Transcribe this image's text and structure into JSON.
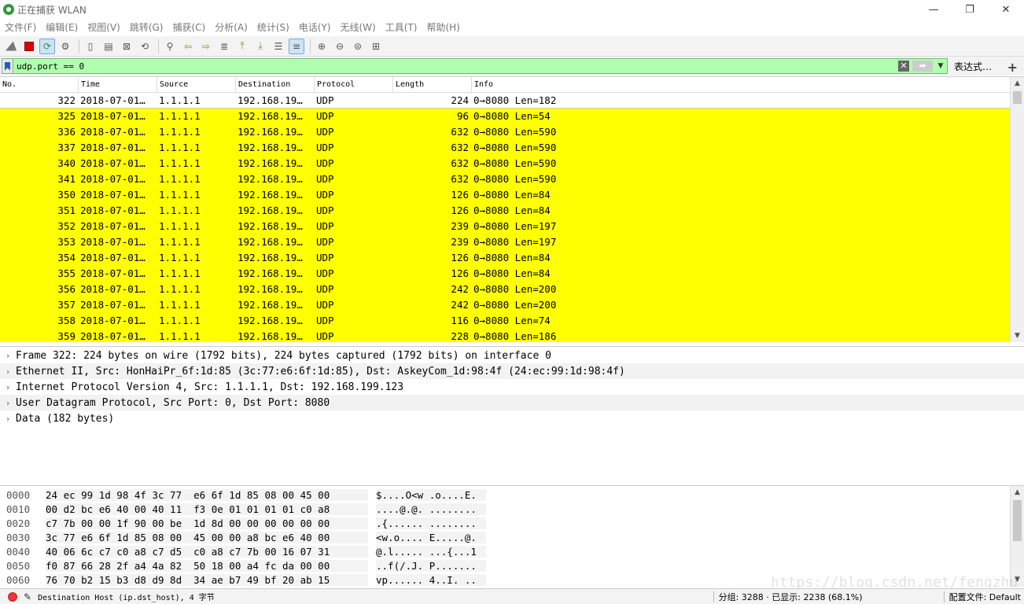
{
  "window": {
    "title": "正在捕获 WLAN",
    "minimize": "—",
    "maximize": "❐",
    "close": "✕"
  },
  "menu": [
    "文件(F)",
    "编辑(E)",
    "视图(V)",
    "跳转(G)",
    "捕获(C)",
    "分析(A)",
    "统计(S)",
    "电话(Y)",
    "无线(W)",
    "工具(T)",
    "帮助(H)"
  ],
  "filter": {
    "value": "udp.port == 0",
    "expression_label": "表达式…",
    "plus": "+"
  },
  "packet_list": {
    "columns": [
      "No.",
      "Time",
      "Source",
      "Destination",
      "Protocol",
      "Length",
      "Info"
    ],
    "rows": [
      {
        "no": "322",
        "time": "2018-07-01…",
        "src": "1.1.1.1",
        "dst": "192.168.19…",
        "proto": "UDP",
        "len": "224",
        "info": "0→8080 Len=182"
      },
      {
        "no": "325",
        "time": "2018-07-01…",
        "src": "1.1.1.1",
        "dst": "192.168.19…",
        "proto": "UDP",
        "len": "96",
        "info": "0→8080 Len=54"
      },
      {
        "no": "336",
        "time": "2018-07-01…",
        "src": "1.1.1.1",
        "dst": "192.168.19…",
        "proto": "UDP",
        "len": "632",
        "info": "0→8080 Len=590"
      },
      {
        "no": "337",
        "time": "2018-07-01…",
        "src": "1.1.1.1",
        "dst": "192.168.19…",
        "proto": "UDP",
        "len": "632",
        "info": "0→8080 Len=590"
      },
      {
        "no": "340",
        "time": "2018-07-01…",
        "src": "1.1.1.1",
        "dst": "192.168.19…",
        "proto": "UDP",
        "len": "632",
        "info": "0→8080 Len=590"
      },
      {
        "no": "341",
        "time": "2018-07-01…",
        "src": "1.1.1.1",
        "dst": "192.168.19…",
        "proto": "UDP",
        "len": "632",
        "info": "0→8080 Len=590"
      },
      {
        "no": "350",
        "time": "2018-07-01…",
        "src": "1.1.1.1",
        "dst": "192.168.19…",
        "proto": "UDP",
        "len": "126",
        "info": "0→8080 Len=84"
      },
      {
        "no": "351",
        "time": "2018-07-01…",
        "src": "1.1.1.1",
        "dst": "192.168.19…",
        "proto": "UDP",
        "len": "126",
        "info": "0→8080 Len=84"
      },
      {
        "no": "352",
        "time": "2018-07-01…",
        "src": "1.1.1.1",
        "dst": "192.168.19…",
        "proto": "UDP",
        "len": "239",
        "info": "0→8080 Len=197"
      },
      {
        "no": "353",
        "time": "2018-07-01…",
        "src": "1.1.1.1",
        "dst": "192.168.19…",
        "proto": "UDP",
        "len": "239",
        "info": "0→8080 Len=197"
      },
      {
        "no": "354",
        "time": "2018-07-01…",
        "src": "1.1.1.1",
        "dst": "192.168.19…",
        "proto": "UDP",
        "len": "126",
        "info": "0→8080 Len=84"
      },
      {
        "no": "355",
        "time": "2018-07-01…",
        "src": "1.1.1.1",
        "dst": "192.168.19…",
        "proto": "UDP",
        "len": "126",
        "info": "0→8080 Len=84"
      },
      {
        "no": "356",
        "time": "2018-07-01…",
        "src": "1.1.1.1",
        "dst": "192.168.19…",
        "proto": "UDP",
        "len": "242",
        "info": "0→8080 Len=200"
      },
      {
        "no": "357",
        "time": "2018-07-01…",
        "src": "1.1.1.1",
        "dst": "192.168.19…",
        "proto": "UDP",
        "len": "242",
        "info": "0→8080 Len=200"
      },
      {
        "no": "358",
        "time": "2018-07-01…",
        "src": "1.1.1.1",
        "dst": "192.168.19…",
        "proto": "UDP",
        "len": "116",
        "info": "0→8080 Len=74"
      },
      {
        "no": "359",
        "time": "2018-07-01…",
        "src": "1.1.1.1",
        "dst": "192.168.19…",
        "proto": "UDP",
        "len": "228",
        "info": "0→8080 Len=186"
      }
    ]
  },
  "details": [
    "Frame 322: 224 bytes on wire (1792 bits), 224 bytes captured (1792 bits) on interface 0",
    "Ethernet II, Src: HonHaiPr_6f:1d:85 (3c:77:e6:6f:1d:85), Dst: AskeyCom_1d:98:4f (24:ec:99:1d:98:4f)",
    "Internet Protocol Version 4, Src: 1.1.1.1, Dst: 192.168.199.123",
    "User Datagram Protocol, Src Port: 0, Dst Port: 8080",
    "Data (182 bytes)"
  ],
  "hex": [
    {
      "offset": "0000",
      "bytes": "24 ec 99 1d 98 4f 3c 77  e6 6f 1d 85 08 00 45 00",
      "ascii": "$....O<w .o....E."
    },
    {
      "offset": "0010",
      "bytes": "00 d2 bc e6 40 00 40 11  f3 0e 01 01 01 01 c0 a8",
      "ascii": "....@.@. ........"
    },
    {
      "offset": "0020",
      "bytes": "c7 7b 00 00 1f 90 00 be  1d 8d 00 00 00 00 00 00",
      "ascii": ".{...... ........"
    },
    {
      "offset": "0030",
      "bytes": "3c 77 e6 6f 1d 85 08 00  45 00 00 a8 bc e6 40 00",
      "ascii": "<w.o.... E.....@."
    },
    {
      "offset": "0040",
      "bytes": "40 06 6c c7 c0 a8 c7 d5  c0 a8 c7 7b 00 16 07 31",
      "ascii": "@.l..... ...{...1"
    },
    {
      "offset": "0050",
      "bytes": "f0 87 66 28 2f a4 4a 82  50 18 00 a4 fc da 00 00",
      "ascii": "..f(/.J. P......."
    },
    {
      "offset": "0060",
      "bytes": "76 70 b2 15 b3 d8 d9 8d  34 ae b7 49 bf 20 ab 15",
      "ascii": "vp...... 4..I. .."
    }
  ],
  "status": {
    "field": "Destination Host (ip.dst_host), 4 字节",
    "packets": "分组: 3288 · 已显示: 2238 (68.1%)",
    "profile": "配置文件: Default",
    "watermark": "https://blog.csdn.net/fengzhu"
  },
  "colors": {
    "highlight": "#ffff00",
    "filter_ok": "#afffaf"
  }
}
